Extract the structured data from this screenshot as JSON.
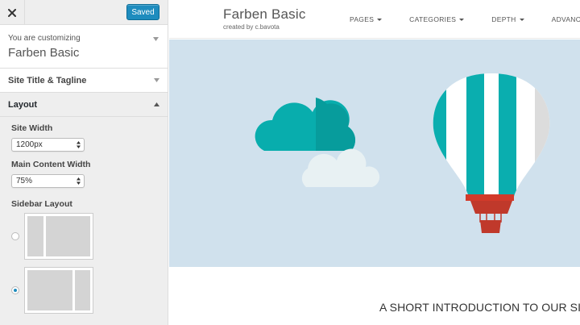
{
  "topbar": {
    "close_icon": "close-icon",
    "saved_label": "Saved",
    "saved_color": "#1e8cbe"
  },
  "info": {
    "customizing_label": "You are customizing",
    "theme_name": "Farben Basic"
  },
  "sections": {
    "site_title": "Site Title & Tagline",
    "layout": "Layout"
  },
  "layout": {
    "site_width_label": "Site Width",
    "site_width_value": "1200px",
    "main_content_label": "Main Content Width",
    "main_content_value": "75%",
    "sidebar_layout_label": "Sidebar Layout",
    "sidebar_options": [
      {
        "selected": false
      },
      {
        "selected": true
      }
    ]
  },
  "preview": {
    "site_title": "Farben Basic",
    "tagline": "created by c.bavota",
    "menu": [
      "PAGES",
      "CATEGORIES",
      "DEPTH",
      "ADVANCED"
    ],
    "hero_bg": "#d0e1ed",
    "intro_heading": "A SHORT INTRODUCTION TO OUR SI"
  }
}
